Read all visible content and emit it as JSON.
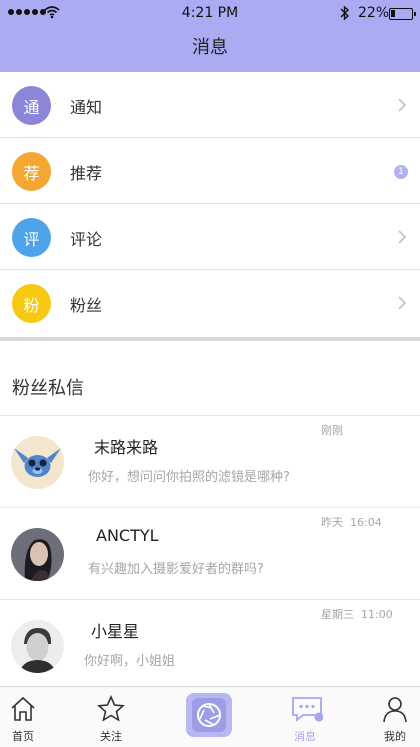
{
  "status_bar": {
    "time": "4:21 PM",
    "battery": "22%"
  },
  "header": {
    "title": "消息"
  },
  "categories": [
    {
      "avatar_char": "通",
      "label": "通知",
      "color": "#8c86d9",
      "trailing": "chevron"
    },
    {
      "avatar_char": "荐",
      "label": "推荐",
      "color": "#f5a733",
      "trailing": "badge",
      "badge": "1"
    },
    {
      "avatar_char": "评",
      "label": "评论",
      "color": "#4fa3e8",
      "trailing": "chevron"
    },
    {
      "avatar_char": "粉",
      "label": "粉丝",
      "color": "#f7c912",
      "trailing": "chevron"
    }
  ],
  "section": {
    "title": "粉丝私信"
  },
  "messages": [
    {
      "name": "末路来路",
      "preview": "你好，想问问你拍照的滤镜是哪种?",
      "time": "刚刚",
      "avatar": "cartoon-character"
    },
    {
      "name": "ANCTYL",
      "preview": "有兴趣加入摄影爱好者的群吗?",
      "time": "昨天  16:04",
      "avatar": "woman-portrait"
    },
    {
      "name": "小星星",
      "preview": "你好啊，小姐姐",
      "time": "星期三  11:00",
      "avatar": "man-portrait"
    }
  ],
  "tabbar": {
    "items": [
      {
        "label": "首页",
        "icon": "home-icon"
      },
      {
        "label": "关注",
        "icon": "star-icon"
      },
      {
        "label": "",
        "icon": "camera-aperture-icon"
      },
      {
        "label": "消息",
        "icon": "message-icon",
        "active": true
      },
      {
        "label": "我的",
        "icon": "profile-icon"
      }
    ],
    "accent": "#a7a7ee"
  }
}
